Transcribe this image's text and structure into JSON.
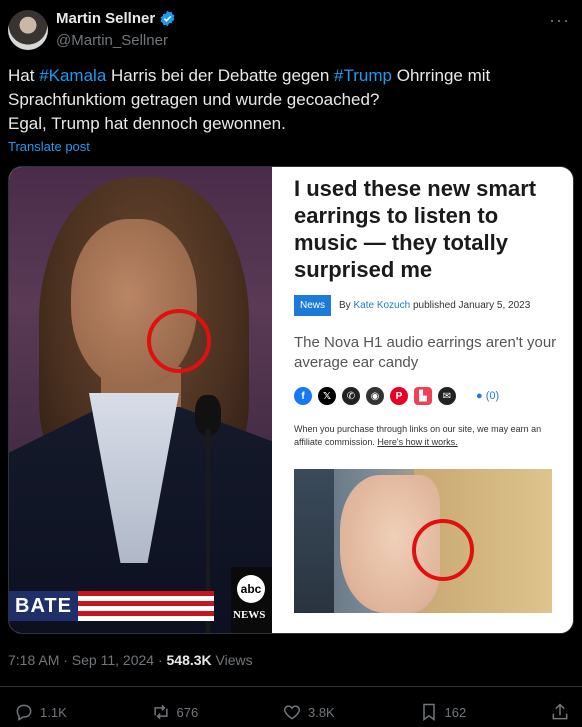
{
  "author": {
    "name": "Martin Sellner",
    "handle": "@Martin_Sellner"
  },
  "tweet": {
    "parts": [
      {
        "text": "Hat ",
        "hashtag": false
      },
      {
        "text": "#Kamala",
        "hashtag": true
      },
      {
        "text": " Harris bei der Debatte gegen ",
        "hashtag": false
      },
      {
        "text": "#Trump",
        "hashtag": true
      },
      {
        "text": " Ohrringe mit Sprachfunktiom getragen und wurde gecoached?",
        "hashtag": false
      }
    ],
    "line2": "Egal, Trump hat dennoch gewonnen.",
    "translate_label": "Translate post"
  },
  "media": {
    "debate_label": "BATE",
    "network_logo": "abc",
    "network_label": "NEWS",
    "article": {
      "headline": "I used these new smart earrings to listen to music — they totally surprised me",
      "tag": "News",
      "by_prefix": "By",
      "author": "Kate Kozuch",
      "published": "published January 5, 2023",
      "subhead": "The Nova H1 audio earrings aren't your average ear candy",
      "comments": "(0)",
      "disclaimer": "When you purchase through links on our site, we may earn an affiliate commission.",
      "disclaimer_link": "Here's how it works."
    }
  },
  "meta": {
    "timestamp": "7:18 AM · Sep 11, 2024 · ",
    "views_count": "548.3K",
    "views_label": " Views"
  },
  "actions": {
    "replies": "1.1K",
    "reposts": "676",
    "likes": "3.8K",
    "bookmarks": "162"
  },
  "colors": {
    "accent": "#1d9bf0",
    "circle": "#e01010"
  }
}
